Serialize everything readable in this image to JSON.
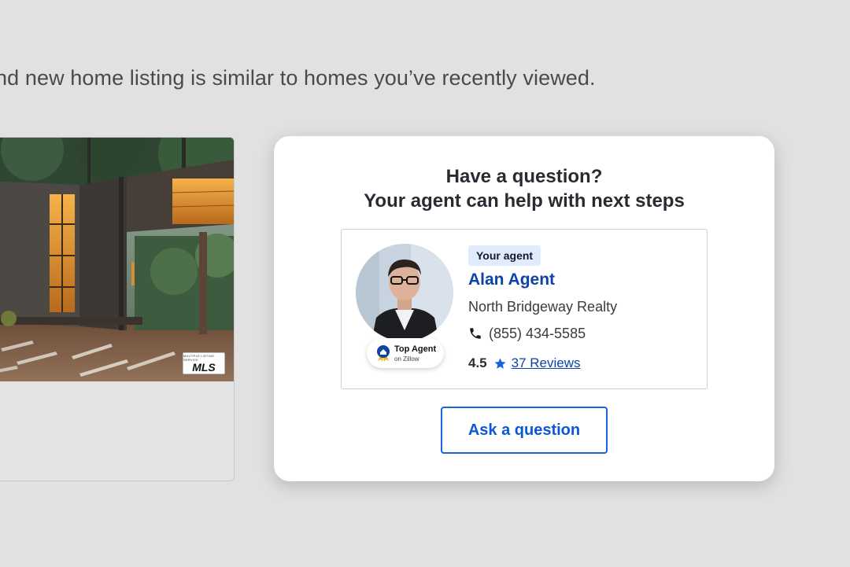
{
  "intro_text": "nd new home listing is similar to homes you’ve recently viewed.",
  "listing": {
    "mls_badge_small": "MULTIPLE LISTING SERVICE",
    "mls_badge": "MLS"
  },
  "agent_card": {
    "title_line1": "Have a question?",
    "title_line2": "Your agent can help with next steps",
    "tag": "Your agent",
    "agent_name": "Alan Agent",
    "company": "North Bridgeway Realty",
    "phone": "(855) 434-5585",
    "rating": "4.5",
    "reviews_link": "37 Reviews",
    "badge_title": "Top Agent",
    "badge_sub": "on Zillow",
    "ask_button": "Ask a question"
  },
  "icons": {
    "phone": "phone-icon",
    "star": "star-icon",
    "badge": "top-agent-medal-icon"
  },
  "colors": {
    "brand_blue": "#0d43a6",
    "button_border": "#1b64e0",
    "tag_background": "#e0ecfb",
    "page_background": "#e1e1e1"
  }
}
